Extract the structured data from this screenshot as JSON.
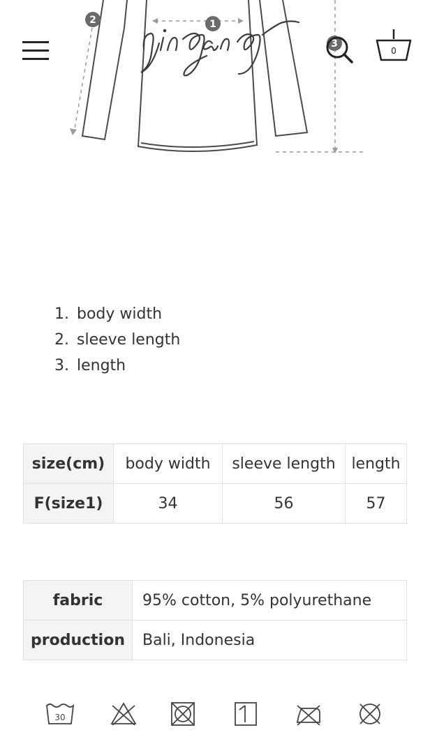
{
  "header": {
    "logo_text": "yinyang",
    "cart_count": "0",
    "icons": [
      "menu-icon",
      "search-icon",
      "basket-icon"
    ]
  },
  "diagram": {
    "markers": [
      "1",
      "2",
      "3"
    ]
  },
  "measurements": [
    {
      "num": "1.",
      "label": "body width"
    },
    {
      "num": "2.",
      "label": "sleeve length"
    },
    {
      "num": "3.",
      "label": "length"
    }
  ],
  "size_table": {
    "headers": [
      "size(cm)",
      "body width",
      "sleeve length",
      "length"
    ],
    "row": [
      "F(size1)",
      "34",
      "56",
      "57"
    ]
  },
  "fabric_table": {
    "rows": [
      {
        "label": "fabric",
        "value": "95% cotton, 5% polyurethane"
      },
      {
        "label": "production",
        "value": "Bali, Indonesia"
      }
    ]
  },
  "care": {
    "wash_temp": "30",
    "icons": [
      "wash-30-icon",
      "do-not-bleach-icon",
      "do-not-tumble-dry-icon",
      "dry-flat-icon",
      "do-not-iron-icon",
      "do-not-dry-clean-icon"
    ]
  }
}
